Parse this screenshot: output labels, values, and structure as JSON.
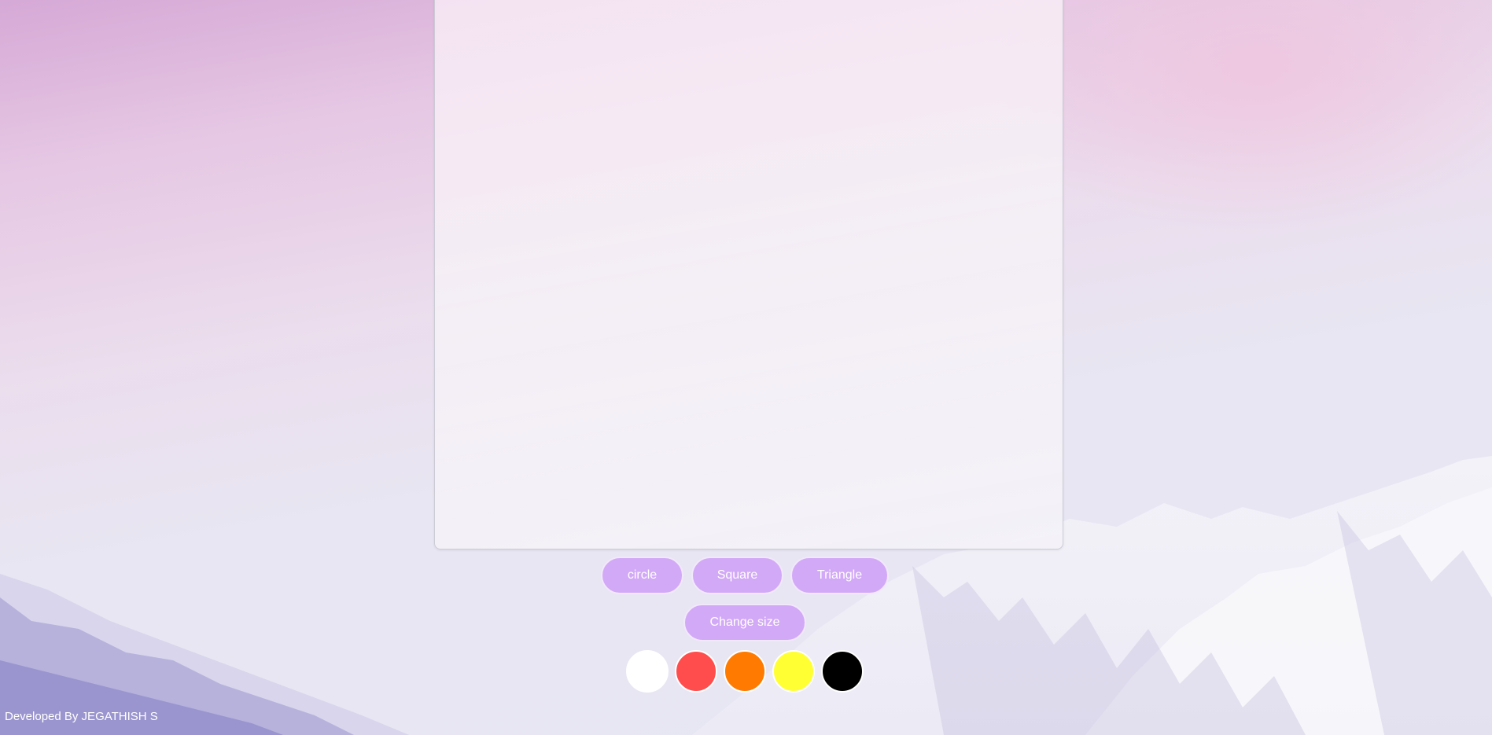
{
  "board": {
    "shape_buttons": [
      {
        "label": "circle"
      },
      {
        "label": "Square"
      },
      {
        "label": "Triangle"
      }
    ],
    "size_button": {
      "label": "Change size"
    },
    "colors": [
      {
        "name": "white",
        "hex": "#ffffff"
      },
      {
        "name": "red",
        "hex": "#ff4d4d"
      },
      {
        "name": "orange",
        "hex": "#ff7a00"
      },
      {
        "name": "yellow",
        "hex": "#ffff33"
      },
      {
        "name": "black",
        "hex": "#000000"
      }
    ],
    "button_color": "#d2a9f6"
  },
  "footer": {
    "credit": "Developed By JEGATHISH S"
  }
}
